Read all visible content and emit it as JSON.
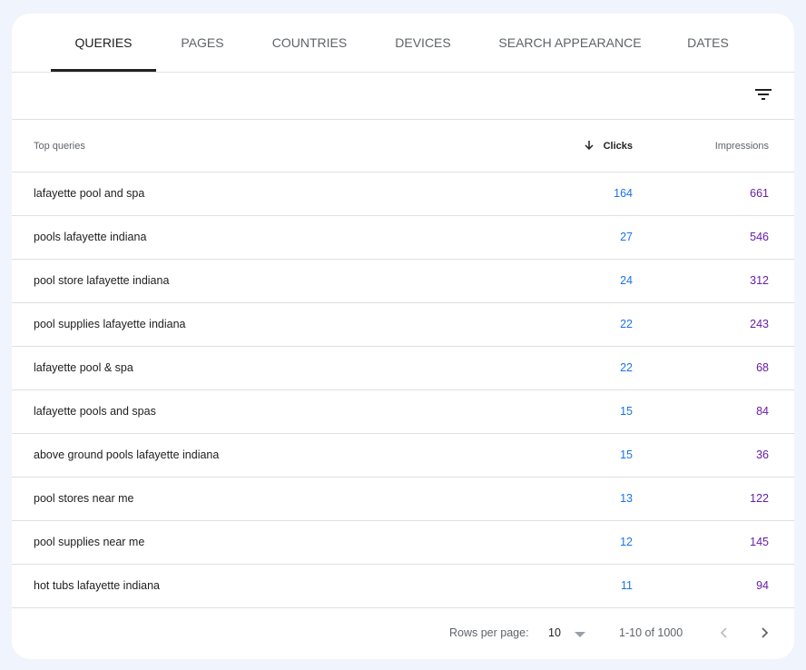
{
  "tabs": [
    {
      "label": "QUERIES",
      "active": true
    },
    {
      "label": "PAGES"
    },
    {
      "label": "COUNTRIES"
    },
    {
      "label": "DEVICES"
    },
    {
      "label": "SEARCH APPEARANCE"
    },
    {
      "label": "DATES"
    }
  ],
  "table": {
    "headers": {
      "query": "Top queries",
      "clicks": "Clicks",
      "impressions": "Impressions"
    },
    "sort": {
      "column": "clicks",
      "direction": "descending",
      "icon": "arrow-down-icon"
    },
    "rows": [
      {
        "query": "lafayette pool and spa",
        "clicks": "164",
        "impressions": "661"
      },
      {
        "query": "pools lafayette indiana",
        "clicks": "27",
        "impressions": "546"
      },
      {
        "query": "pool store lafayette indiana",
        "clicks": "24",
        "impressions": "312"
      },
      {
        "query": "pool supplies lafayette indiana",
        "clicks": "22",
        "impressions": "243"
      },
      {
        "query": "lafayette pool & spa",
        "clicks": "22",
        "impressions": "68"
      },
      {
        "query": "lafayette pools and spas",
        "clicks": "15",
        "impressions": "84"
      },
      {
        "query": "above ground pools lafayette indiana",
        "clicks": "15",
        "impressions": "36"
      },
      {
        "query": "pool stores near me",
        "clicks": "13",
        "impressions": "122"
      },
      {
        "query": "pool supplies near me",
        "clicks": "12",
        "impressions": "145"
      },
      {
        "query": "hot tubs lafayette indiana",
        "clicks": "11",
        "impressions": "94"
      }
    ]
  },
  "footer": {
    "rows_label": "Rows per page:",
    "rows_value": "10",
    "range": "1-10 of 1000"
  },
  "colors": {
    "clicks": "#1a73e8",
    "impressions": "#681da8",
    "background": "#f0f4fc"
  }
}
